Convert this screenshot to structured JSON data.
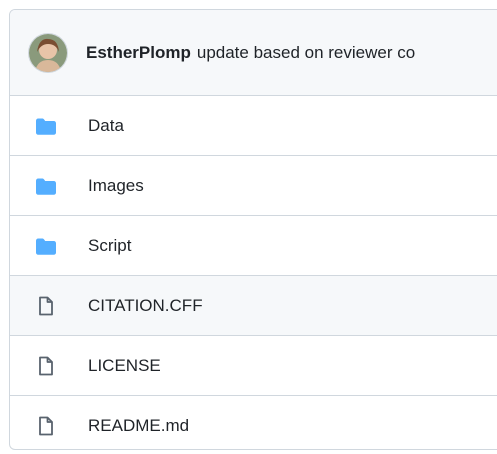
{
  "commit": {
    "author": "EstherPlomp",
    "message": "update based on reviewer co"
  },
  "files": [
    {
      "name": "Data",
      "type": "folder",
      "icon": "folder-icon"
    },
    {
      "name": "Images",
      "type": "folder",
      "icon": "folder-icon"
    },
    {
      "name": "Script",
      "type": "folder",
      "icon": "folder-icon"
    },
    {
      "name": "CITATION.CFF",
      "type": "file",
      "icon": "file-icon"
    },
    {
      "name": "LICENSE",
      "type": "file",
      "icon": "file-icon"
    },
    {
      "name": "README.md",
      "type": "file",
      "icon": "file-icon"
    }
  ],
  "colors": {
    "folder": "#54aeff",
    "file_icon": "#59636e",
    "border": "#d0d7de",
    "header_bg": "#f6f8fa"
  }
}
